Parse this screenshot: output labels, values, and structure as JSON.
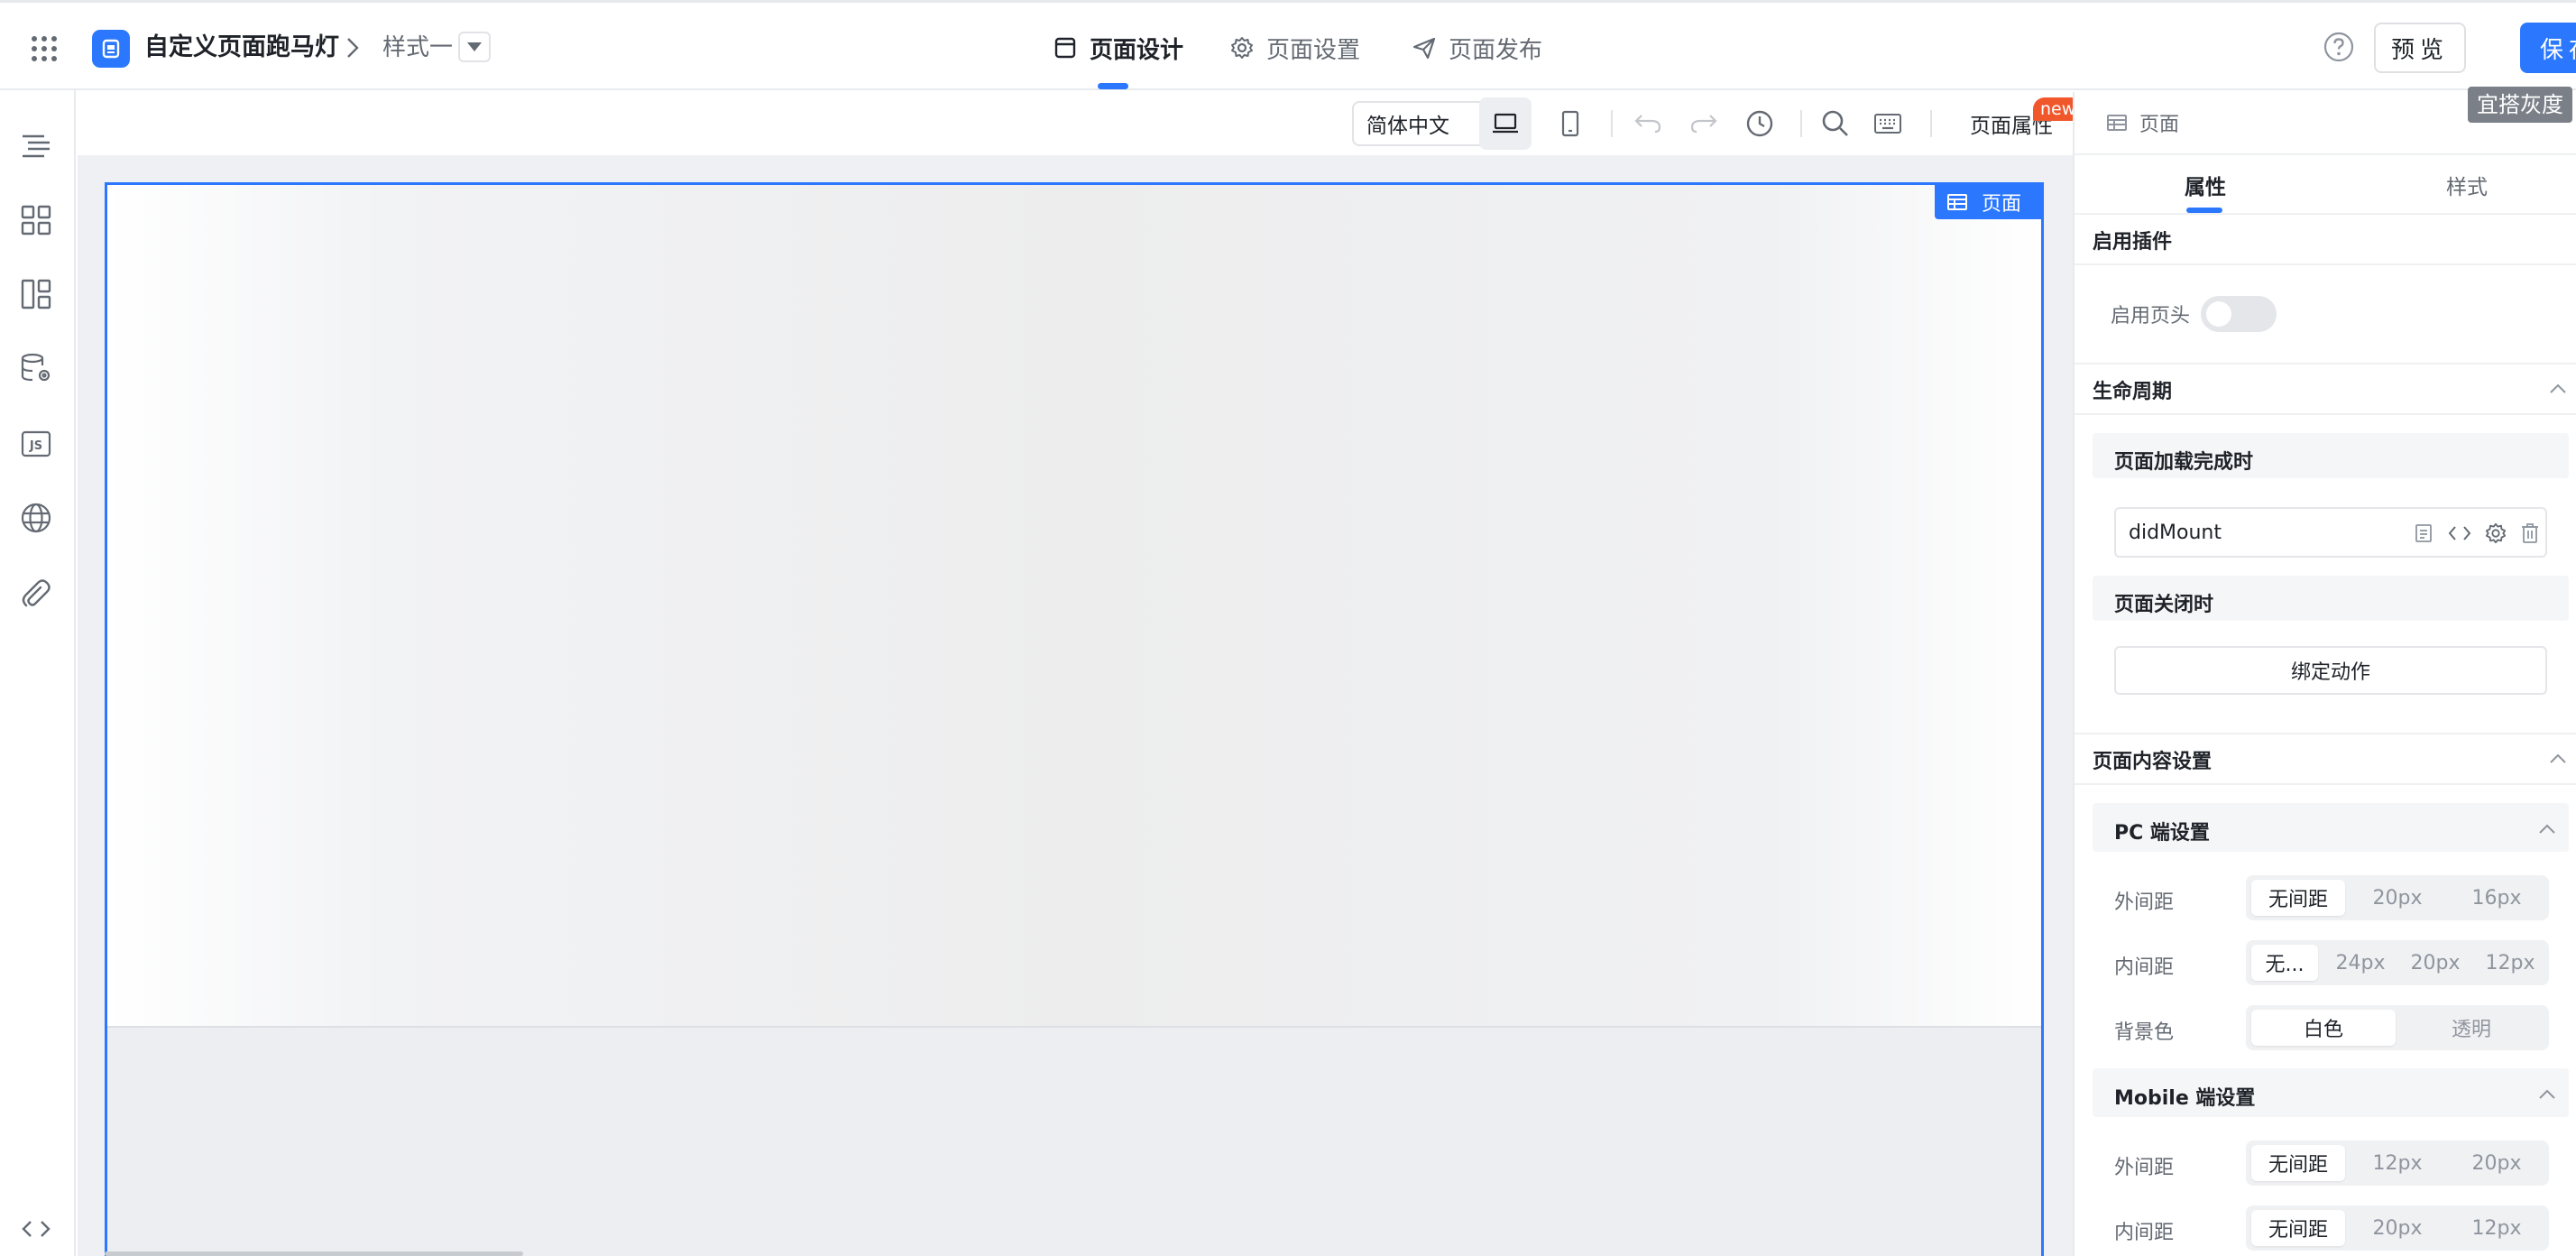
{
  "header": {
    "app_title": "自定义页面跑马灯",
    "breadcrumb_style": "样式一",
    "tabs": [
      {
        "label": "页面设计",
        "icon": "layout-icon",
        "active": true
      },
      {
        "label": "页面设置",
        "icon": "gear-icon",
        "active": false
      },
      {
        "label": "页面发布",
        "icon": "send-icon",
        "active": false
      }
    ],
    "preview_label": "预览",
    "save_label": "保存",
    "accent_color": "#2b78ff"
  },
  "left_rail": {
    "items": [
      "outline-icon",
      "components-icon",
      "layout-icon",
      "datasource-icon",
      "js-icon",
      "globe-icon",
      "attachment-icon"
    ],
    "bottom": "code-icon"
  },
  "toolbar": {
    "language": "简体中文",
    "page_attr_label": "页面属性",
    "new_badge": "new",
    "tools": [
      "desktop-icon",
      "mobile-icon",
      "undo-icon",
      "redo-icon",
      "history-icon",
      "search-icon",
      "keyboard-icon"
    ]
  },
  "canvas": {
    "page_tag": "页面"
  },
  "right_panel": {
    "head_title": "页面",
    "gray_tag": "宜搭灰度",
    "tabs": [
      {
        "label": "属性",
        "active": true
      },
      {
        "label": "样式",
        "active": false
      }
    ],
    "plugin_section": {
      "title": "启用插件",
      "header_label": "启用页头",
      "header_enabled": false
    },
    "lifecycle": {
      "title": "生命周期",
      "on_load_title": "页面加载完成时",
      "on_load_handler": "didMount",
      "on_close_title": "页面关闭时",
      "bind_action_label": "绑定动作"
    },
    "content_settings": {
      "title": "页面内容设置",
      "pc": {
        "title": "PC 端设置",
        "margin_label": "外间距",
        "margin_options": [
          "无间距",
          "20px",
          "16px"
        ],
        "margin_selected": "无间距",
        "padding_label": "内间距",
        "padding_options": [
          "无...",
          "24px",
          "20px",
          "12px"
        ],
        "padding_selected": "无...",
        "bg_label": "背景色",
        "bg_options": [
          "白色",
          "透明"
        ],
        "bg_selected": "白色"
      },
      "mobile": {
        "title": "Mobile 端设置",
        "margin_label": "外间距",
        "margin_options": [
          "无间距",
          "12px",
          "20px"
        ],
        "margin_selected": "无间距",
        "padding_label": "内间距",
        "padding_options": [
          "无间距",
          "20px",
          "12px"
        ],
        "padding_selected": "无间距"
      }
    }
  }
}
